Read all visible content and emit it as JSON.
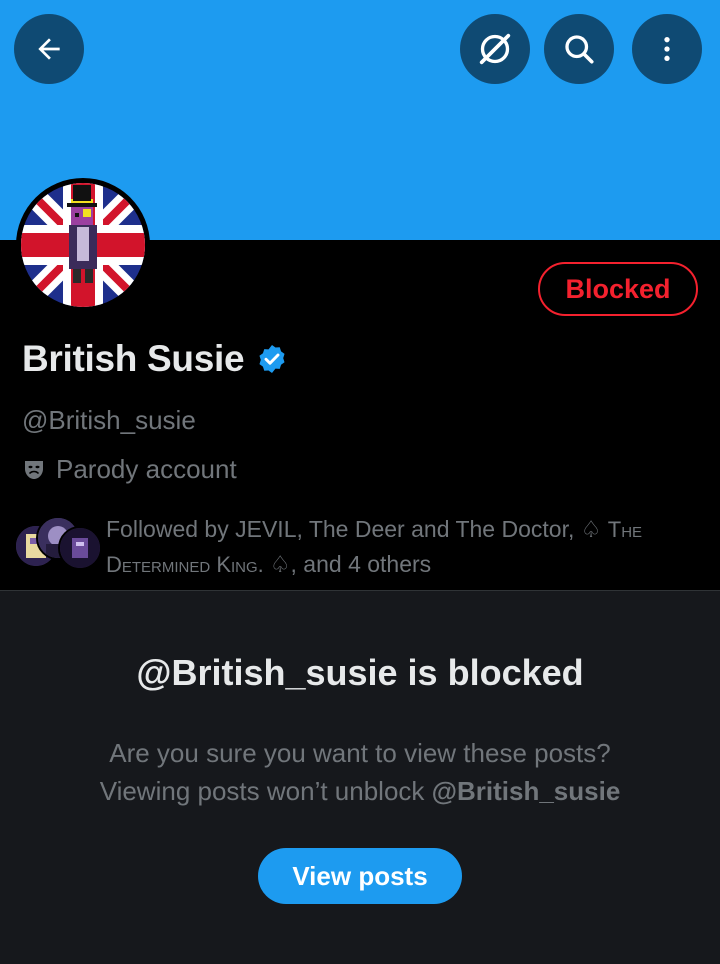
{
  "colors": {
    "banner": "#1d9bf0",
    "icon_button_bg": "#0f4a73",
    "blocked_red": "#f4212e",
    "primary_blue": "#1d9bf0",
    "text_primary": "#e7e9ea",
    "text_secondary": "#71767b",
    "panel_bg": "#16181c"
  },
  "header": {
    "back_icon": "arrow-left-icon",
    "grok_icon": "grok-icon",
    "search_icon": "search-icon",
    "more_icon": "more-vertical-icon"
  },
  "profile": {
    "display_name": "British Susie",
    "verified_icon": "verified-badge-icon",
    "handle": "@British_susie",
    "parody_label": "Parody account",
    "parody_icon": "theater-mask-icon",
    "blocked_button": "Blocked"
  },
  "followers": {
    "prefix": "Followed by JEVIL, The Deer and The Doctor, ♤ ",
    "smallcaps_name": "The Determined King. ",
    "suffix": "♤, and 4 others"
  },
  "blocked_notice": {
    "title": "@British_susie is blocked",
    "line1": "Are you sure you want to view these posts?",
    "line2_prefix": "Viewing posts won’t unblock ",
    "line2_handle": "@British_susie",
    "button": "View posts"
  }
}
